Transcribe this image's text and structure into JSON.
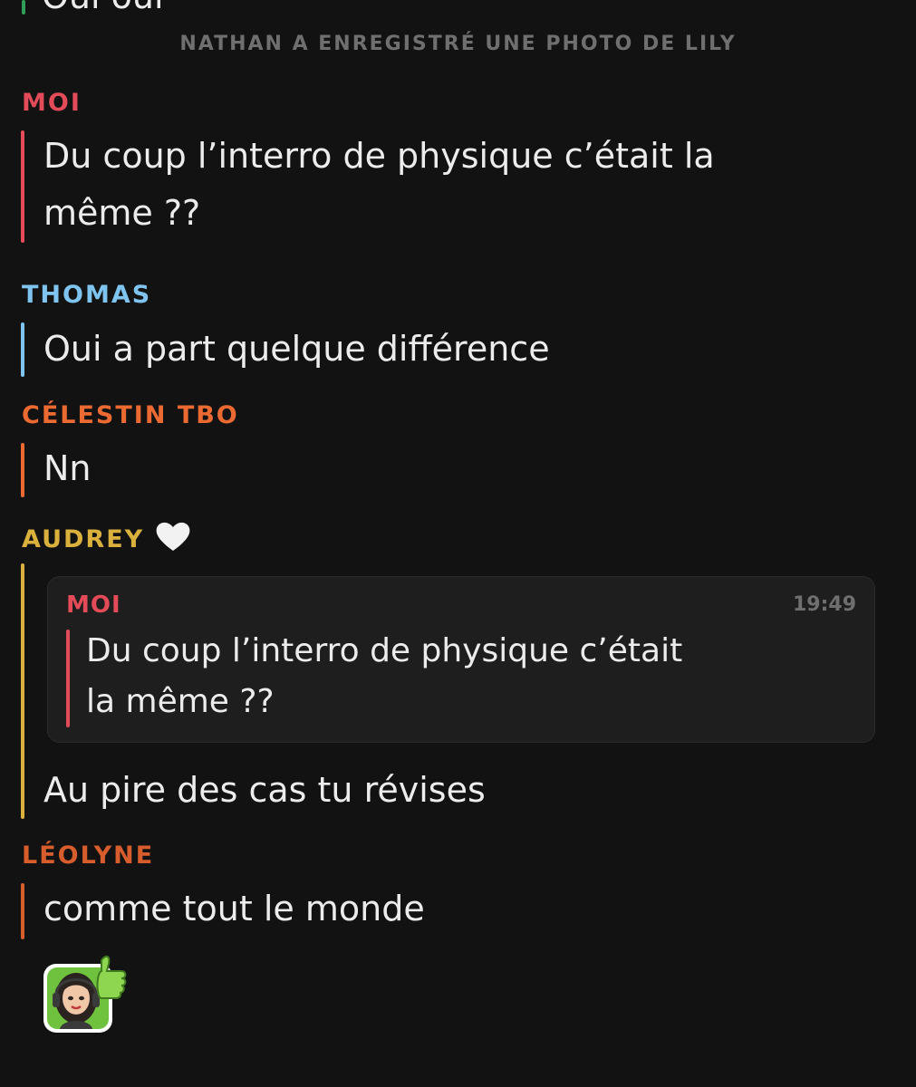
{
  "colors": {
    "background": "#121212",
    "me": "#e24b57",
    "thomas": "#7fc4ef",
    "celestin": "#ea6a32",
    "audrey": "#d9b13c",
    "leolyne": "#d85d2c",
    "truncated_top": "#2f9e58",
    "system_text": "#6f6f6f",
    "quote_bg": "#1e1e1e"
  },
  "truncated_top_text": "Oui oui",
  "system_message": "NATHAN A ENREGISTRÉ UNE PHOTO DE LILY",
  "messages": [
    {
      "sender": "MOI",
      "lines": [
        "Du coup l’interro de physique c’était la",
        "même ??"
      ]
    },
    {
      "sender": "THOMAS",
      "lines": [
        "Oui a part quelque différence"
      ]
    },
    {
      "sender": "CÉLESTIN TBO",
      "lines": [
        "Nn"
      ]
    },
    {
      "sender": "AUDREY",
      "sender_icon": "white-heart-icon",
      "reply_to": {
        "sender": "MOI",
        "time": "19:49",
        "lines": [
          "Du coup l’interro de physique c’était",
          "la même ??"
        ]
      },
      "lines": [
        "Au pire des cas tu révises"
      ]
    },
    {
      "sender": "LÉOLYNE",
      "lines": [
        "comme tout le monde"
      ]
    }
  ],
  "bottom_icon": "bitmoji-thumbs-up-sticker"
}
